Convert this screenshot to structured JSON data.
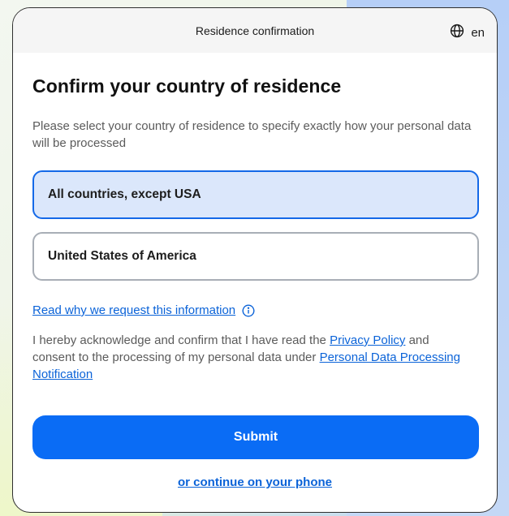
{
  "header": {
    "title": "Residence confirmation",
    "language": "en",
    "language_icon": "globe-icon"
  },
  "main": {
    "heading": "Confirm your country of residence",
    "description": "Please select your country of residence to specify exactly how your personal data will be processed",
    "options": [
      {
        "label": "All countries, except USA",
        "selected": true
      },
      {
        "label": "United States of America",
        "selected": false
      }
    ],
    "read_why_link": "Read why we request this information",
    "read_why_icon": "info-icon",
    "consent": {
      "text_before": "I hereby acknowledge and confirm that I have read the ",
      "privacy_link": "Privacy Policy",
      "text_middle": " and consent to the processing of my personal data under ",
      "notification_link": "Personal Data Processing Notification"
    },
    "submit_label": "Submit",
    "phone_link": "or continue on your phone"
  },
  "colors": {
    "accent": "#0a6cf5",
    "selected_bg": "#dbe7fb",
    "selected_border": "#1469e8",
    "link": "#0b63d8"
  }
}
